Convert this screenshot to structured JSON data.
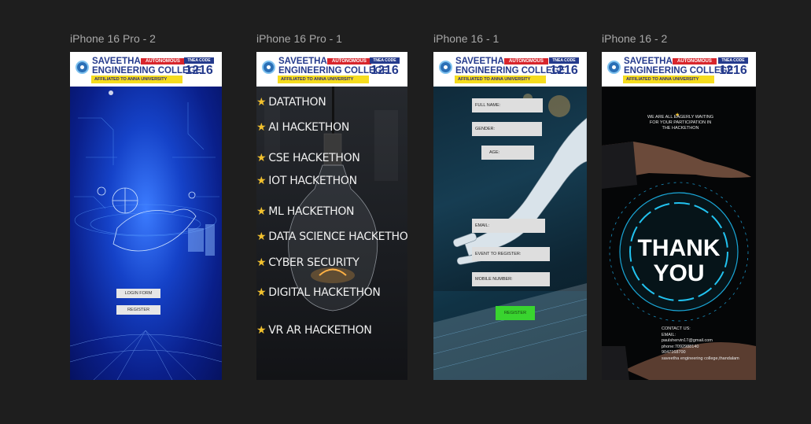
{
  "frames": [
    {
      "id": "f1",
      "title": "iPhone 16 Pro - 2"
    },
    {
      "id": "f2",
      "title": "iPhone 16 Pro - 1"
    },
    {
      "id": "f3",
      "title": "iPhone 16 - 1"
    },
    {
      "id": "f4",
      "title": "iPhone 16 - 2"
    }
  ],
  "header": {
    "college_line1": "SAVEETHA",
    "college_line2": "ENGINEERING COLLEGE",
    "autonomous": "AUTONOMOUS",
    "affiliated": "AFFILIATED TO ANNA UNIVERSITY",
    "tnea_label": "TNEA CODE",
    "tnea_code": "1216"
  },
  "login": {
    "login_form": "LOGIN   FORM",
    "register": "REGISTER"
  },
  "hackathons": [
    "DATATHON",
    "AI HACKETHON",
    "CSE  HACKETHON",
    "IOT HACKETHON",
    "ML HACKETHON",
    "DATA SCIENCE HACKETHON",
    "CYBER SECURITY",
    "DIGITAL HACKETHON",
    "VR AR HACKETHON"
  ],
  "form": {
    "full_name": "FULL NAME:",
    "gender": "GENDER:",
    "age": "AGE:",
    "email": "EMAIL:",
    "event": "EVENT TO REGISTER:",
    "mobile": "MOBILE NUMBER:",
    "register": "REGISTER"
  },
  "thanks": {
    "waiting1": "WE ARE ALL EAGERLY WAITING",
    "waiting2": "FOR YOUR PARTICIPATION IN",
    "waiting3": "THE HACKETHON",
    "thank": "THANK",
    "you": "YOU",
    "contact": "CONTACT US:",
    "email_label": "EMAIL:",
    "email": "paulshervin17@gmail.com",
    "phone": "phone:7092988140",
    "phone2": "9047168700",
    "address": "saveetha engineering college,thandalam"
  },
  "colors": {
    "canvas": "#1e1e1e",
    "brand_blue": "#243a8c",
    "register_green": "#39d42f",
    "star": "#f2c12e"
  }
}
